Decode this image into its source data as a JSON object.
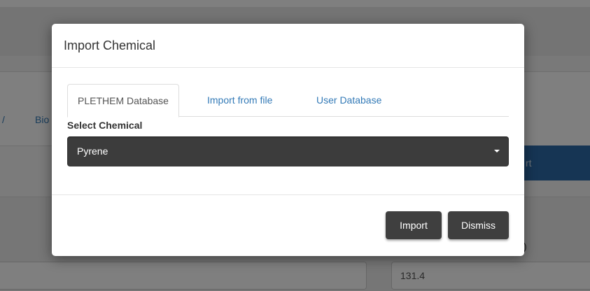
{
  "background": {
    "tab_fragment_left": "/",
    "tab_fragment": "Bio",
    "button_fragment": "rt",
    "paren_fragment": ")",
    "field_value": "131.4"
  },
  "modal": {
    "title": "Import Chemical",
    "tabs": [
      {
        "label": "PLETHEM Database",
        "active": true
      },
      {
        "label": "Import from file",
        "active": false
      },
      {
        "label": "User Database",
        "active": false
      }
    ],
    "select_label": "Select Chemical",
    "selected_chemical": "Pyrene",
    "buttons": {
      "import": "Import",
      "dismiss": "Dismiss"
    }
  },
  "colors": {
    "link": "#337ab7",
    "dark_button": "#3f3f3f",
    "select_bg": "#3c3c3c",
    "overlay": "rgba(0,0,0,0.5)"
  },
  "icons": {
    "select_caret": "caret-down-icon"
  }
}
